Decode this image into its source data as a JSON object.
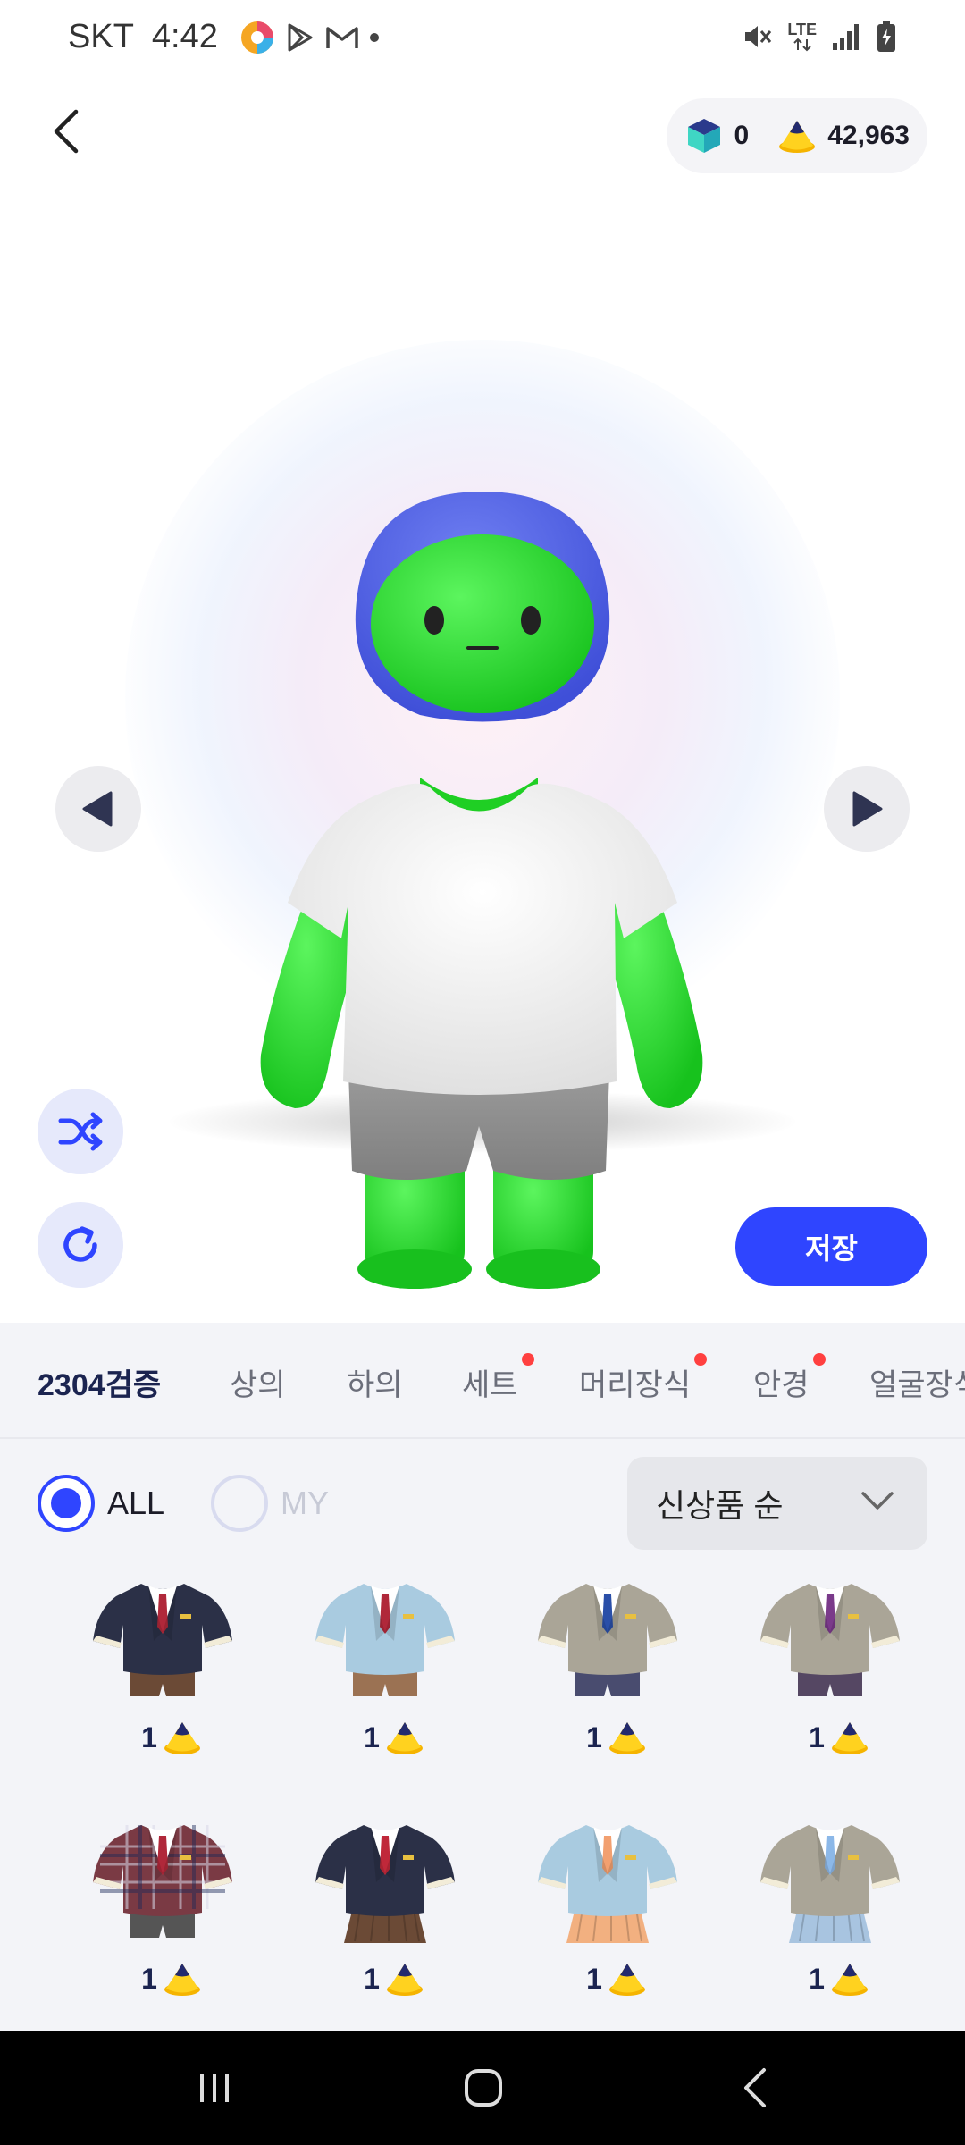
{
  "status_bar": {
    "carrier": "SKT",
    "time": "4:42",
    "notification_icons": [
      "colorful-app-icon",
      "play-store-icon",
      "gmail-icon",
      "dot-icon"
    ],
    "system_icons": [
      "mute-icon",
      "lte-icon",
      "signal-icon",
      "battery-charging-icon"
    ],
    "network_label": "LTE"
  },
  "header": {
    "back_icon": "chevron-left-icon",
    "gems": "0",
    "coins": "42,963"
  },
  "avatar": {
    "head_color": "#22d82a",
    "hood_color": "#5061e6",
    "shirt_color": "#f2f2f2",
    "shorts_color": "#8e8e8e"
  },
  "controls": {
    "prev_icon": "triangle-left-icon",
    "next_icon": "triangle-right-icon",
    "shuffle_icon": "shuffle-icon",
    "reset_icon": "refresh-icon",
    "save_label": "저장"
  },
  "tabs": [
    {
      "label": "2304검증",
      "active": true,
      "dot": false
    },
    {
      "label": "상의",
      "active": false,
      "dot": false
    },
    {
      "label": "하의",
      "active": false,
      "dot": false
    },
    {
      "label": "세트",
      "active": false,
      "dot": true
    },
    {
      "label": "머리장식",
      "active": false,
      "dot": true
    },
    {
      "label": "안경",
      "active": false,
      "dot": true
    },
    {
      "label": "얼굴장식",
      "active": false,
      "dot": false
    }
  ],
  "filters": {
    "all_label": "ALL",
    "my_label": "MY",
    "selected": "ALL",
    "sort_label": "신상품 순"
  },
  "items": [
    {
      "price": "1",
      "jacket": "#2b3047",
      "shirt": "#ffffff",
      "tie": "#b0283a",
      "bottom": "#6b4a36",
      "kind": "shorts"
    },
    {
      "price": "1",
      "jacket": "#a9cbe0",
      "shirt": "#ffffff",
      "tie": "#b0283a",
      "bottom": "#9b7253",
      "kind": "shorts"
    },
    {
      "price": "1",
      "jacket": "#aaa597",
      "shirt": "#ffffff",
      "tie": "#2a4fa8",
      "bottom": "#494c6f",
      "kind": "shorts"
    },
    {
      "price": "1",
      "jacket": "#aaa597",
      "shirt": "#ffffff",
      "tie": "#7a3a8a",
      "bottom": "#554763",
      "kind": "shorts"
    },
    {
      "price": "1",
      "jacket": "#7a3a44",
      "shirt": "#ffffff",
      "tie": "#b0283a",
      "bottom": "#555555",
      "kind": "shorts",
      "plaid": true
    },
    {
      "price": "1",
      "jacket": "#2b3047",
      "shirt": "#ffffff",
      "tie": "#c0283a",
      "bottom": "#6b4a36",
      "kind": "skirt"
    },
    {
      "price": "1",
      "jacket": "#a9cbe0",
      "shirt": "#ffffff",
      "tie": "#f2a070",
      "bottom": "#f2b080",
      "kind": "skirt"
    },
    {
      "price": "1",
      "jacket": "#aaa597",
      "shirt": "#ffffff",
      "tie": "#8cb8e8",
      "bottom": "#a8c4e0",
      "kind": "skirt"
    }
  ],
  "nav": {
    "recents_icon": "recent-apps-icon",
    "home_icon": "home-icon",
    "back_icon": "back-icon"
  },
  "colors": {
    "accent": "#2f45ff",
    "dot": "#ff4040"
  }
}
